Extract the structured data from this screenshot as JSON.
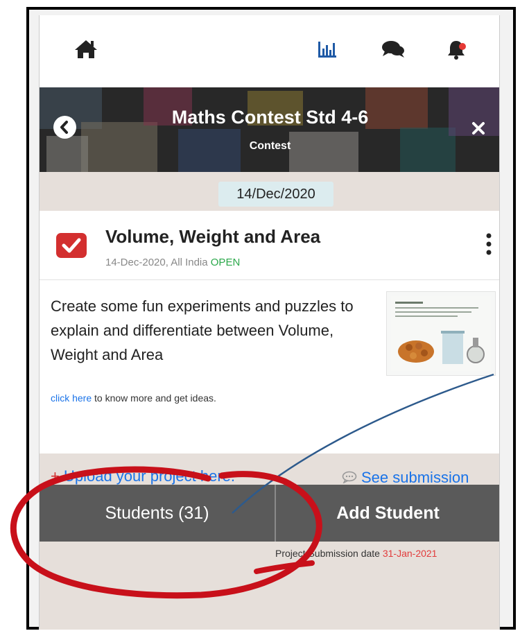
{
  "banner": {
    "title": "Maths Contest Std 4-6",
    "subtitle": "Contest"
  },
  "date_chip": "14/Dec/2020",
  "contest": {
    "title": "Volume, Weight and Area",
    "meta_date": "14-Dec-2020, All India",
    "status": "OPEN",
    "description": "Create some fun experiments and puzzles to explain and differentiate between Volume, Weight and Area",
    "link_text": "click here",
    "link_suffix": " to know more and get ideas.",
    "upload_prefix": "+",
    "upload_label": " Upload your project here.",
    "see_submission_label": "See submission"
  },
  "actions": {
    "students_label": "Students (31)",
    "add_student_label": "Add Student"
  },
  "submission": {
    "label": "Project Submission date",
    "date": "31-Jan-2021"
  },
  "icons": {
    "home": "home-icon",
    "stats": "bar-chart-icon",
    "chat": "chat-icon",
    "bell": "bell-icon",
    "back": "chevron-left-icon",
    "close": "close-icon",
    "check": "checkbox-checked-icon",
    "more": "kebab-menu-icon",
    "submission": "speech-bubble-icon"
  },
  "colors": {
    "accent_red": "#d32f2f",
    "link_blue": "#1a73e8",
    "status_green": "#2aa84a",
    "action_bar": "#5a5a5a",
    "annotation_red": "#c8101a",
    "annotation_line": "#2d5a8c"
  }
}
